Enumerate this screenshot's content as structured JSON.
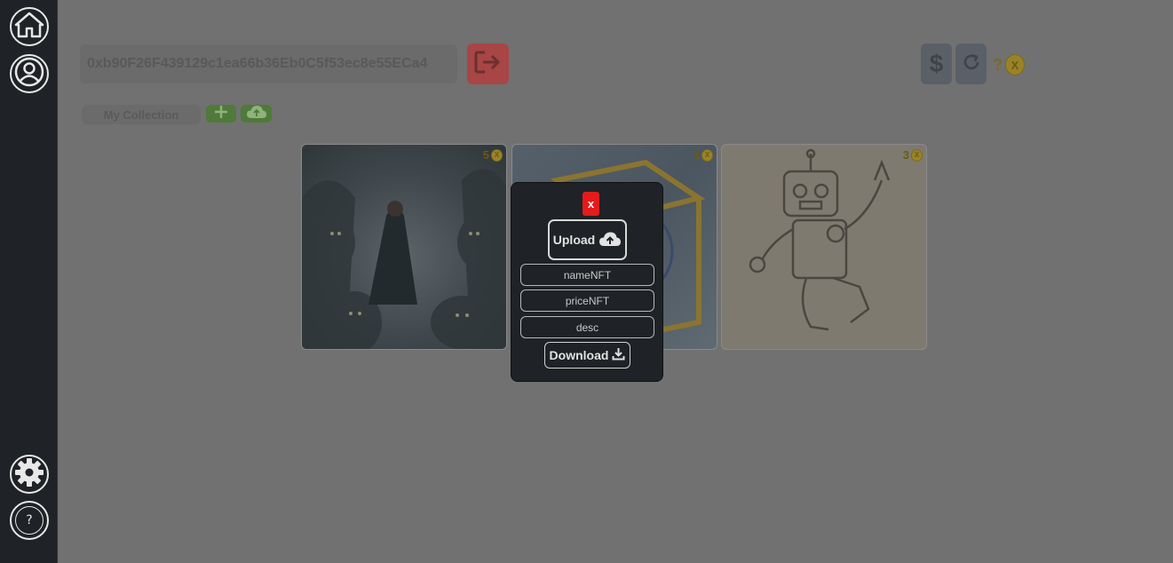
{
  "sidebar": {
    "home_icon": "home-icon",
    "profile_icon": "user-circle-icon",
    "settings_icon": "gear-icon",
    "help_label": "?"
  },
  "header": {
    "wallet_address": "0xb90F26F439129c1ea66b36Eb0C5f53ec8e55ECa4",
    "logout_icon": "sign-out-icon",
    "dollar_label": "$",
    "refresh_icon": "refresh-icon",
    "balance_value": "?",
    "coin_icon": "coin-icon"
  },
  "collection": {
    "tab_label": "My Collection",
    "add_icon": "plus-icon",
    "upload_icon": "cloud-upload-icon"
  },
  "cards": [
    {
      "price": "5",
      "subject": "dark forest ghouls"
    },
    {
      "price": "3",
      "subject": "golden cube"
    },
    {
      "price": "3",
      "subject": "dancing robot sketch"
    }
  ],
  "modal": {
    "close_label": "x",
    "upload_label": "Upload",
    "name_placeholder": "nameNFT",
    "price_placeholder": "priceNFT",
    "desc_placeholder": "desc",
    "download_label": "Download"
  },
  "colors": {
    "sidebar_bg": "#1f2226",
    "main_bg": "#717171",
    "logout": "#a84545",
    "green": "#4f7a3a",
    "close": "#e41b1b",
    "coin": "#9a8326"
  }
}
